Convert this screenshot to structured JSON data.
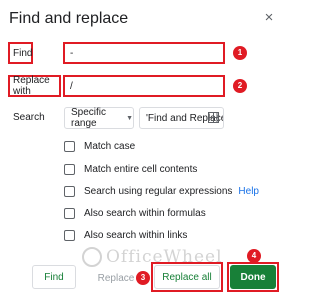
{
  "dialog": {
    "title": "Find and replace",
    "close_icon": "×"
  },
  "find": {
    "label": "Find",
    "value": "-"
  },
  "replace": {
    "label": "Replace with",
    "value": "/"
  },
  "search": {
    "label": "Search",
    "scope_value": "Specific range",
    "range_value": "'Find and Replace'"
  },
  "options": {
    "match_case": "Match case",
    "match_entire": "Match entire cell contents",
    "regex": "Search using regular expressions",
    "help": "Help",
    "formulas": "Also search within formulas",
    "links": "Also search within links"
  },
  "buttons": {
    "find": "Find",
    "replace": "Replace",
    "replace_all": "Replace all",
    "done": "Done"
  },
  "badges": [
    "1",
    "2",
    "3",
    "4"
  ],
  "watermark": "OfficeWheel",
  "colors": {
    "highlight": "#e01b24",
    "primary_green": "#188038",
    "link_blue": "#1a73e8"
  }
}
